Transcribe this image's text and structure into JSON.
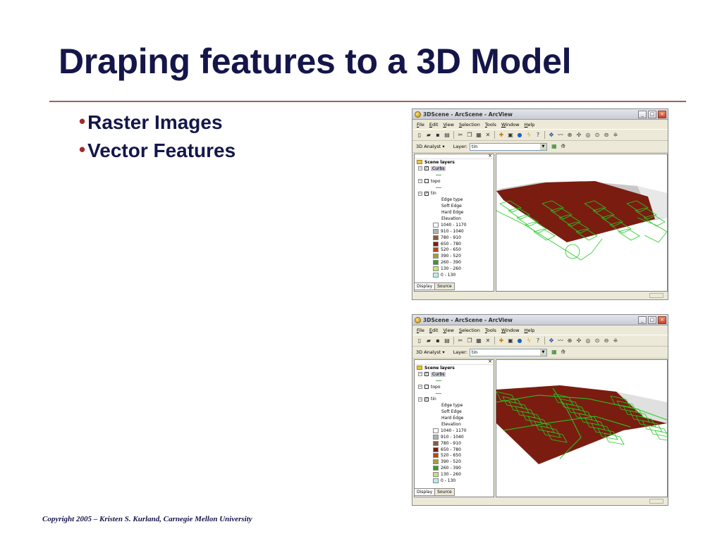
{
  "slide": {
    "title": "Draping features to a 3D Model",
    "bullets": [
      "Raster Images",
      "Vector Features"
    ],
    "bullet_glyph": "•",
    "footer": "Copyright 2005 – Kristen S. Kurland, Carnegie Mellon University"
  },
  "window": {
    "title": "3DScene - ArcScene - ArcView",
    "buttons": {
      "minimize": "_",
      "maximize": "□",
      "close": "×"
    },
    "menus": [
      "File",
      "Edit",
      "View",
      "Selection",
      "Tools",
      "Window",
      "Help"
    ],
    "toolbar_icons": [
      "new-icon",
      "open-icon",
      "save-icon",
      "print-icon",
      "cut-icon",
      "copy-icon",
      "paste-icon",
      "delete-icon",
      "add-data-icon",
      "layer-icon",
      "globe-icon",
      "lightning-icon",
      "help-icon",
      "navigate-icon",
      "fly-icon",
      "zoom-in-icon",
      "pan-icon",
      "zoom-out-icon",
      "full-extent-icon",
      "zoom-layer-icon",
      "expand-icon"
    ],
    "analyst_label": "3D Analyst ▾",
    "layer_label": "Layer:",
    "layer_value": "tin",
    "toc": {
      "root": "Scene layers",
      "layers": [
        "Curbs",
        "topo",
        "tin"
      ],
      "tin_items": [
        "Edge type",
        "Soft Edge",
        "Hard Edge",
        "Elevation"
      ],
      "legend": [
        {
          "label": "1040 - 1170",
          "color": "#ffffff"
        },
        {
          "label": "910 - 1040",
          "color": "#b0b0b0"
        },
        {
          "label": "780 - 910",
          "color": "#8a5a3a"
        },
        {
          "label": "650 - 780",
          "color": "#7a1d10"
        },
        {
          "label": "520 - 650",
          "color": "#b04a18"
        },
        {
          "label": "390 - 520",
          "color": "#a0a040"
        },
        {
          "label": "260 - 390",
          "color": "#3a9a30"
        },
        {
          "label": "130 - 260",
          "color": "#c0e870"
        },
        {
          "label": "0 - 130",
          "color": "#b8f0f0"
        }
      ],
      "tabs": [
        "Display",
        "Source"
      ]
    }
  },
  "colors": {
    "title": "#14164a",
    "bullet_dot": "#a52a2a",
    "terrain": "#7a1d10",
    "curbs": "#22cc22"
  }
}
